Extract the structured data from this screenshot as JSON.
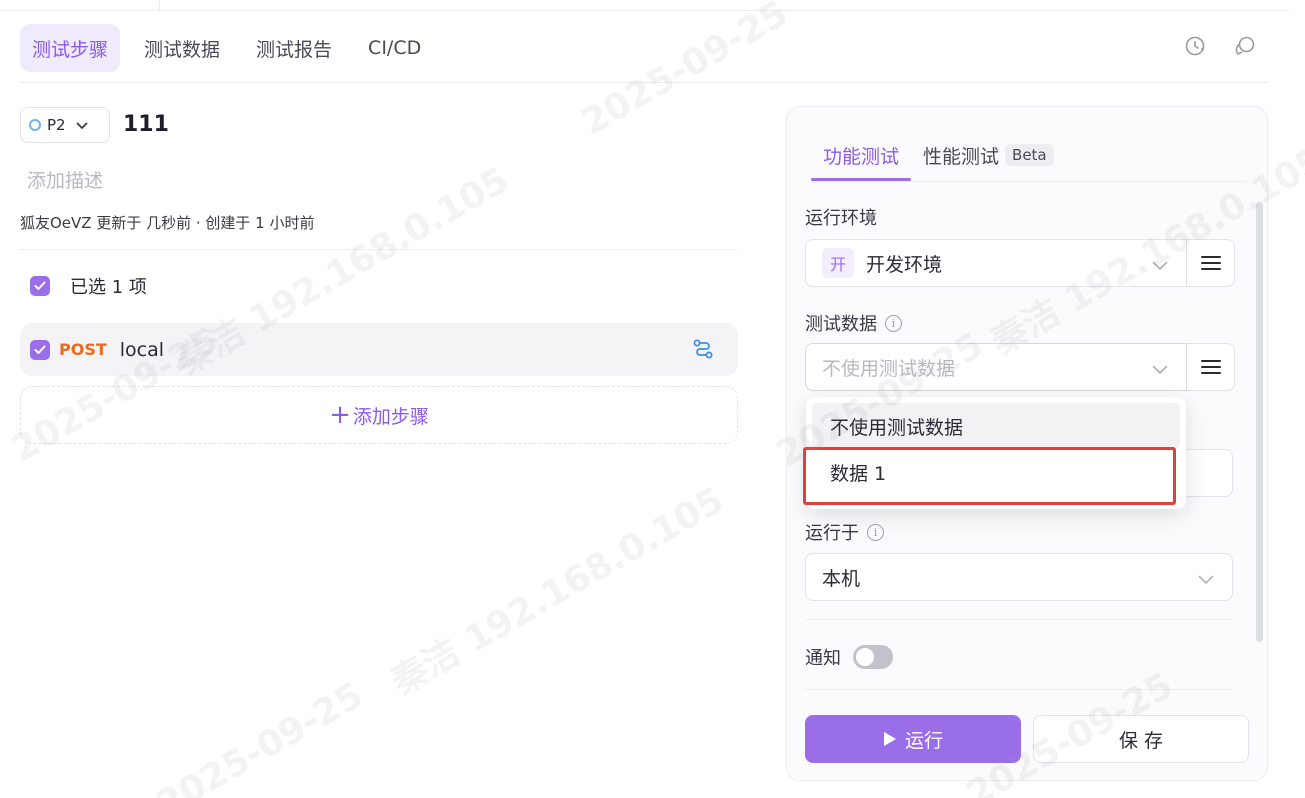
{
  "top_tabs": [
    {
      "label": "测试步骤",
      "active": true
    },
    {
      "label": "测试数据",
      "active": false
    },
    {
      "label": "测试报告",
      "active": false
    },
    {
      "label": "CI/CD",
      "active": false
    }
  ],
  "case": {
    "priority": "P2",
    "title": "111",
    "description_placeholder": "添加描述",
    "meta": "狐友OeVZ 更新于 几秒前 · 创建于 1 小时前"
  },
  "selection": {
    "label": "已选 1 项"
  },
  "steps": [
    {
      "method": "POST",
      "name": "local"
    }
  ],
  "add_step_label": "添加步骤",
  "panel": {
    "tabs": [
      {
        "label": "功能测试",
        "active": true
      },
      {
        "label": "性能测试",
        "active": false,
        "badge": "Beta"
      }
    ],
    "env": {
      "label": "运行环境",
      "badge": "开",
      "value": "开发环境"
    },
    "test_data": {
      "label": "测试数据",
      "placeholder": "不使用测试数据"
    },
    "run_on": {
      "label": "运行于",
      "value": "本机"
    },
    "notify": {
      "label": "通知",
      "enabled": false
    },
    "run_button": "运行",
    "save_button": "保 存"
  },
  "dropdown": {
    "options": [
      "不使用测试数据",
      "数据 1"
    ],
    "hovered_index": 0,
    "highlighted_index": 1
  },
  "watermark": {
    "date": "2025-09-25",
    "name": "秦洁",
    "ip": "192.168.0.105"
  },
  "colors": {
    "accent": "#9a6ee9",
    "accent_text": "#8a5be8",
    "post_method": "#ec6a1c",
    "highlight": "#e0403c"
  }
}
